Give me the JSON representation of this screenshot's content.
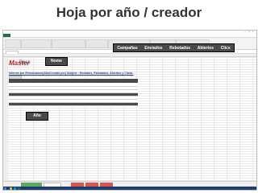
{
  "slide": {
    "title": "Hoja por año / creador"
  },
  "excel": {
    "window_title": "",
    "file_tab": "",
    "ribbon_tabs": [],
    "report_title": "Informe por Remolcamos(Año/Creado por) Subject : Enviados, Rebotados, Abiertos y Clicks.",
    "logo": {
      "text_left": "Master",
      "text_right": "Base",
      "subtitle": ""
    },
    "accent_color": "#1e7145",
    "sheet_tabs": [
      {
        "label": "",
        "color": "#5fa85f"
      },
      {
        "label": "",
        "color": "#ffffff"
      },
      {
        "label": "",
        "color": "#d9534f"
      },
      {
        "label": "",
        "color": "#d9534f"
      },
      {
        "label": "",
        "color": "#d9534f"
      }
    ]
  },
  "callouts": {
    "nome_label": "Nome",
    "ano_label": "Año",
    "metrics": [
      "Campañas",
      "Enviados",
      "Rebotados",
      "Abiertos",
      "Clics"
    ],
    "background": "#4a4a4a"
  }
}
